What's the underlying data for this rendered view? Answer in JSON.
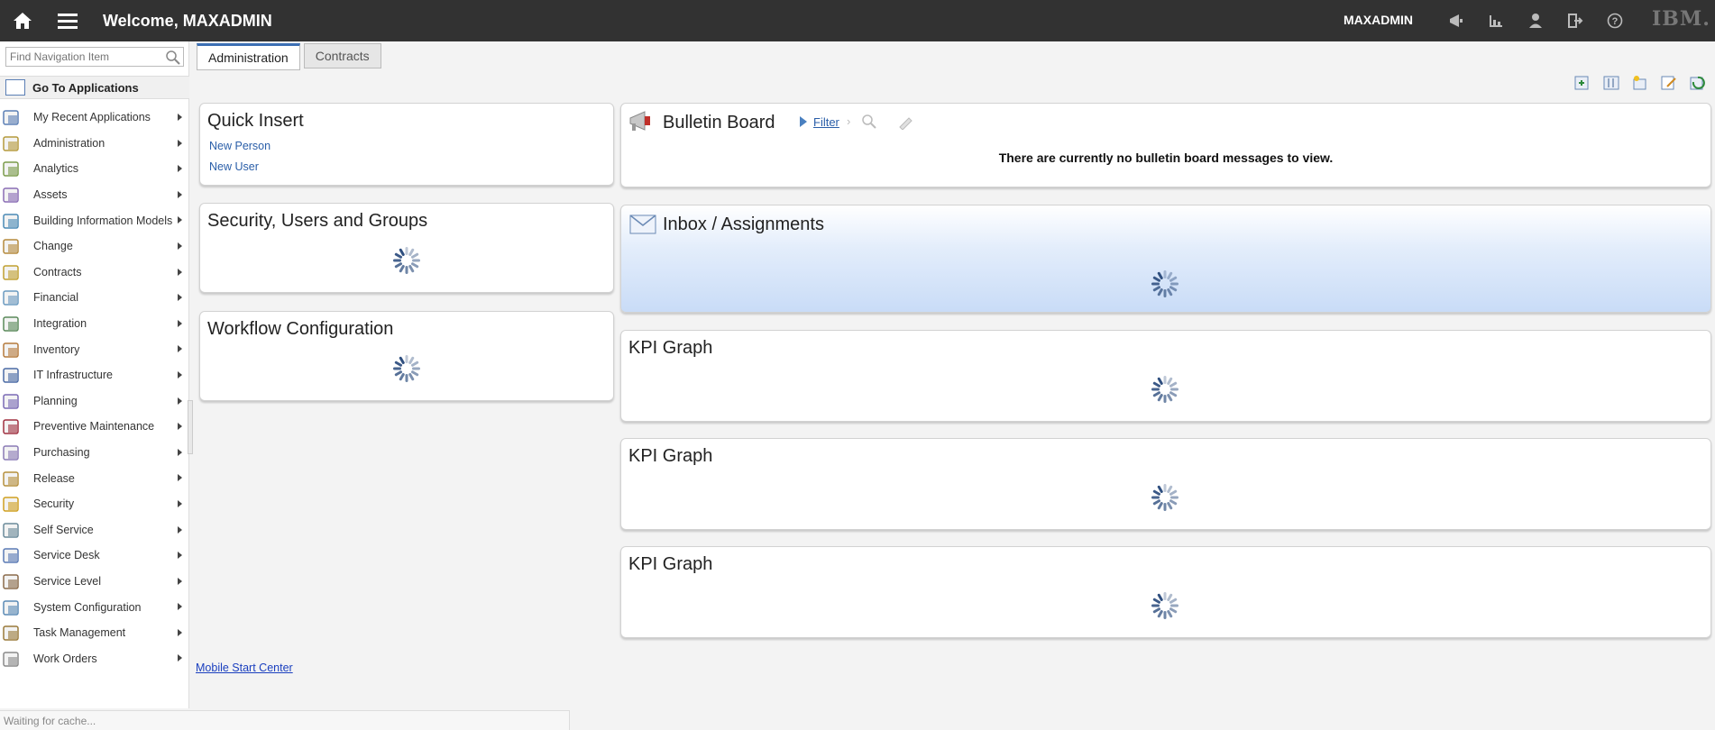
{
  "topbar": {
    "welcome": "Welcome, MAXADMIN",
    "user": "MAXADMIN",
    "brand": "IBM.",
    "icons": [
      "home-icon",
      "menu-icon",
      "bulletin-icon",
      "reports-icon",
      "profile-icon",
      "signout-icon",
      "help-icon"
    ]
  },
  "sidebar": {
    "search_placeholder": "Find Navigation Item",
    "goto_label": "Go To Applications",
    "items": [
      {
        "label": "My Recent Applications",
        "icon": "recent-apps-icon"
      },
      {
        "label": "Administration",
        "icon": "administration-icon"
      },
      {
        "label": "Analytics",
        "icon": "analytics-icon"
      },
      {
        "label": "Assets",
        "icon": "assets-icon"
      },
      {
        "label": "Building Information Models",
        "icon": "building-models-icon"
      },
      {
        "label": "Change",
        "icon": "change-icon"
      },
      {
        "label": "Contracts",
        "icon": "contracts-icon"
      },
      {
        "label": "Financial",
        "icon": "financial-icon"
      },
      {
        "label": "Integration",
        "icon": "integration-icon"
      },
      {
        "label": "Inventory",
        "icon": "inventory-icon"
      },
      {
        "label": "IT Infrastructure",
        "icon": "it-infrastructure-icon"
      },
      {
        "label": "Planning",
        "icon": "planning-icon"
      },
      {
        "label": "Preventive Maintenance",
        "icon": "preventive-maintenance-icon"
      },
      {
        "label": "Purchasing",
        "icon": "purchasing-icon"
      },
      {
        "label": "Release",
        "icon": "release-icon"
      },
      {
        "label": "Security",
        "icon": "security-icon"
      },
      {
        "label": "Self Service",
        "icon": "self-service-icon"
      },
      {
        "label": "Service Desk",
        "icon": "service-desk-icon"
      },
      {
        "label": "Service Level",
        "icon": "service-level-icon"
      },
      {
        "label": "System Configuration",
        "icon": "system-configuration-icon"
      },
      {
        "label": "Task Management",
        "icon": "task-management-icon"
      },
      {
        "label": "Work Orders",
        "icon": "work-orders-icon"
      }
    ]
  },
  "tabs": [
    "Administration",
    "Contracts"
  ],
  "portlets": {
    "quick_insert": {
      "title": "Quick Insert",
      "links": [
        "New Person",
        "New User"
      ]
    },
    "security": {
      "title": "Security, Users and Groups"
    },
    "workflow": {
      "title": "Workflow Configuration"
    },
    "bulletin": {
      "title": "Bulletin Board",
      "filter": "Filter",
      "message": "There are currently no bulletin board messages to view."
    },
    "inbox": {
      "title": "Inbox / Assignments"
    },
    "kpi1": {
      "title": "KPI Graph"
    },
    "kpi2": {
      "title": "KPI Graph"
    },
    "kpi3": {
      "title": "KPI Graph"
    }
  },
  "footer": {
    "mobile_link": "Mobile Start Center",
    "status": "Waiting for cache..."
  },
  "colors": {
    "topbar": "#323232",
    "link": "#2a5ea8",
    "accent": "#3c6fb4"
  }
}
